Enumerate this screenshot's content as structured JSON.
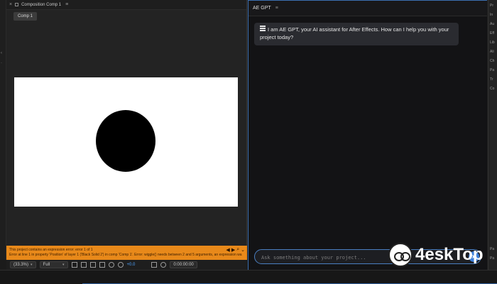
{
  "composition": {
    "panel_title": "Composition Comp 1",
    "tab_label": "Comp 1",
    "error_line1": "This project contains an expression error: error 1 of 1",
    "error_line2": "Error at line 1 in property 'Position' of layer 1 ('Black Solid 2') in comp 'Comp 1'. Error: wiggle() needs between 2 and 5 arguments, an expression wa",
    "zoom": "(33.3%)",
    "resolution": "Full",
    "exposure": "+0.0",
    "timecode": "0:00:00:00"
  },
  "gpt": {
    "panel_title": "AE GPT",
    "message": "I am AE GPT, your AI assistant for After Effects. How can I help you with your project today?",
    "input_placeholder": "Ask something about your project..."
  },
  "right_strip": [
    "Pr",
    "In",
    "Au",
    "Eff",
    "Lib",
    "Ali",
    "Ch",
    "Pa",
    "Tr",
    "Co",
    "Pa",
    "Pa"
  ],
  "watermark": {
    "text": "4eskTop"
  },
  "colors": {
    "accent": "#3d7fd9",
    "error": "#e8891a",
    "panel": "#131315"
  }
}
